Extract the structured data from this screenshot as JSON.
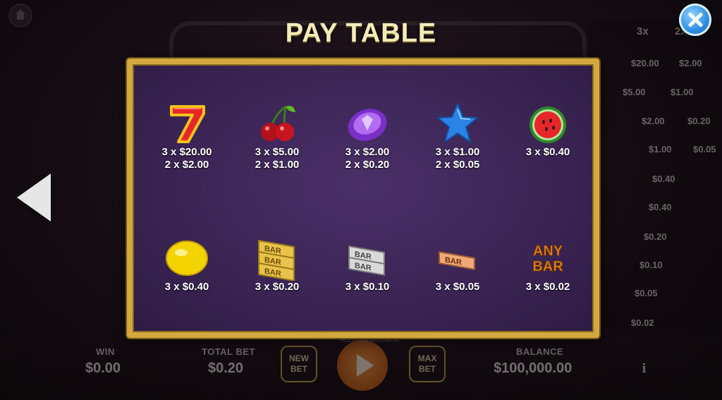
{
  "title": "PAY TABLE",
  "symbols": [
    {
      "name": "seven",
      "icon": "seven-icon",
      "line1": "3 x $20.00",
      "line2": "2 x $2.00"
    },
    {
      "name": "cherry",
      "icon": "cherry-icon",
      "line1": "3 x $5.00",
      "line2": "2 x $1.00"
    },
    {
      "name": "gem",
      "icon": "purple-gem-icon",
      "line1": "3 x $2.00",
      "line2": "2 x $0.20"
    },
    {
      "name": "star",
      "icon": "blue-star-icon",
      "line1": "3 x $1.00",
      "line2": "2 x $0.05"
    },
    {
      "name": "watermelon",
      "icon": "watermelon-icon",
      "line1": "3 x $0.40",
      "line2": ""
    },
    {
      "name": "lemon",
      "icon": "lemon-icon",
      "line1": "3 x $0.40",
      "line2": ""
    },
    {
      "name": "triple-bar",
      "icon": "triple-bar-icon",
      "line1": "3 x $0.20",
      "line2": ""
    },
    {
      "name": "double-bar",
      "icon": "double-bar-icon",
      "line1": "3 x $0.10",
      "line2": ""
    },
    {
      "name": "single-bar",
      "icon": "single-bar-icon",
      "line1": "3 x $0.05",
      "line2": ""
    },
    {
      "name": "any-bar",
      "icon": "any-bar-icon",
      "line1": "3 x $0.02",
      "line2": ""
    }
  ],
  "any_bar_text": {
    "line1": "ANY",
    "line2": "BAR"
  },
  "bar_text": "BAR",
  "background": {
    "side_headers": [
      "3x",
      "2x"
    ],
    "side_rows": [
      {
        "v1": "$20.00",
        "v2": "$2.00"
      },
      {
        "v1": "$5.00",
        "v2": "$1.00"
      },
      {
        "v1": "$2.00",
        "v2": "$0.20"
      },
      {
        "v1": "$1.00",
        "v2": "$0.05"
      },
      {
        "v1": "$0.40",
        "v2": ""
      },
      {
        "v1": "$0.40",
        "v2": ""
      },
      {
        "v1": "$0.20",
        "v2": ""
      },
      {
        "v1": "$0.10",
        "v2": ""
      },
      {
        "v1": "$0.05",
        "v2": ""
      },
      {
        "v1": "$0.02",
        "v2": ""
      }
    ],
    "win_label": "WIN",
    "win_value": "$0.00",
    "total_bet_label": "TOTAL BET",
    "total_bet_value": "$0.20",
    "new_bet_label": "NEW BET",
    "max_bet_label": "MAX BET",
    "hold_text": "HOLD FOR AUTOSPIN",
    "balance_label": "BALANCE",
    "balance_value": "$100,000.00",
    "info_label": "i"
  },
  "colors": {
    "panel_border": "#d3a93f",
    "panel_bg": "#3c2555",
    "title": "#f4ecb8"
  }
}
